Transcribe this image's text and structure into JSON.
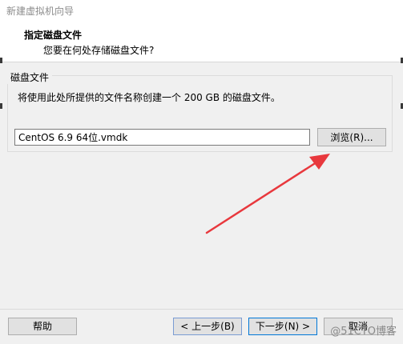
{
  "window": {
    "title": "新建虚拟机向导"
  },
  "header": {
    "title": "指定磁盘文件",
    "subtitle": "您要在何处存储磁盘文件?"
  },
  "disk_group": {
    "title": "磁盘文件",
    "description": "将使用此处所提供的文件名称创建一个 200 GB 的磁盘文件。",
    "file_value": "CentOS 6.9 64位.vmdk",
    "browse_label": "浏览(R)..."
  },
  "footer": {
    "help_label": "帮助",
    "back_label": "< 上一步(B)",
    "next_label": "下一步(N) >",
    "cancel_label": "取消"
  },
  "watermark": "@51CTO博客",
  "colors": {
    "arrow": "#e8383d",
    "accent": "#0078d7"
  }
}
